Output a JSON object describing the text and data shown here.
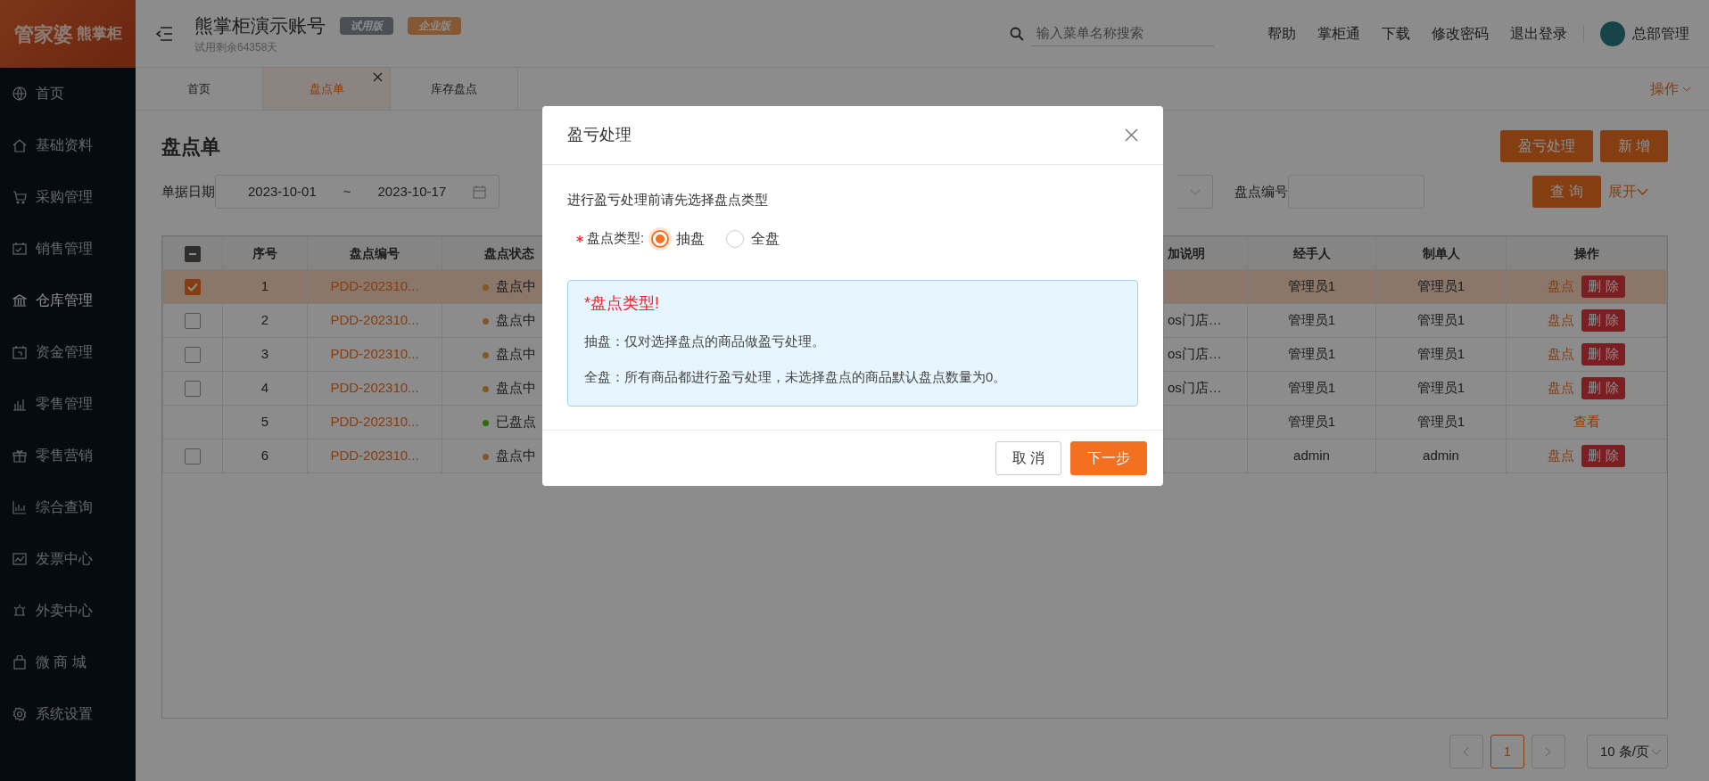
{
  "logo": {
    "brand": "管家婆",
    "product": "熊掌柜"
  },
  "sidebar": {
    "items": [
      {
        "label": "首页",
        "selected": false
      },
      {
        "label": "基础资料",
        "selected": false
      },
      {
        "label": "采购管理",
        "selected": false
      },
      {
        "label": "销售管理",
        "selected": false
      },
      {
        "label": "仓库管理",
        "selected": true
      },
      {
        "label": "资金管理",
        "selected": false
      },
      {
        "label": "零售管理",
        "selected": false
      },
      {
        "label": "零售营销",
        "selected": false
      },
      {
        "label": "综合查询",
        "selected": false
      },
      {
        "label": "发票中心",
        "selected": false
      },
      {
        "label": "外卖中心",
        "selected": false
      },
      {
        "label": "微 商 城",
        "selected": false
      },
      {
        "label": "系统设置",
        "selected": false
      }
    ]
  },
  "header": {
    "title": "熊掌柜演示账号",
    "badges": [
      {
        "label": "试用版",
        "kind": "trial"
      },
      {
        "label": "企业版",
        "kind": "enterprise"
      }
    ],
    "subtitle": "试用剩余64358天",
    "search": {
      "placeholder": "输入菜单名称搜索"
    },
    "links": [
      "帮助",
      "掌柜通",
      "下载",
      "修改密码",
      "退出登录"
    ],
    "user": "总部管理"
  },
  "tabs": [
    {
      "label": "首页",
      "selected": false,
      "closable": false
    },
    {
      "label": "盘点单",
      "selected": true,
      "closable": true
    },
    {
      "label": "库存盘点",
      "selected": false,
      "closable": false
    }
  ],
  "tabs_menu": "操作",
  "page": {
    "title": "盘点单",
    "buttons": [
      "盈亏处理",
      "新 增"
    ]
  },
  "filters": {
    "date_label": "单据日期",
    "date_from": "2023-10-01",
    "date_sep": "~",
    "date_to": "2023-10-17",
    "code_label": "盘点编号",
    "query": "查 询",
    "expand": "展开"
  },
  "table": {
    "header_indeterminate": true,
    "columns": [
      "序号",
      "盘点编号",
      "盘点状态",
      "加说明",
      "经手人",
      "制单人",
      "操作"
    ],
    "rows": [
      {
        "no": "1",
        "code": "PDD-202310...",
        "status": "盘点中",
        "color": "#7f5921",
        "note": "",
        "handler": "管理员1",
        "creator": "管理员1",
        "checked": true,
        "selected": true,
        "actions": [
          {
            "label": "盘点",
            "kind": "link"
          },
          {
            "label": "删 除",
            "kind": "danger"
          }
        ]
      },
      {
        "no": "2",
        "code": "PDD-202310...",
        "status": "盘点中",
        "color": "#7f5921",
        "note": "os门店…",
        "handler": "管理员1",
        "creator": "管理员1",
        "checked": false,
        "selected": false,
        "actions": [
          {
            "label": "盘点",
            "kind": "link"
          },
          {
            "label": "删 除",
            "kind": "danger"
          }
        ]
      },
      {
        "no": "3",
        "code": "PDD-202310...",
        "status": "盘点中",
        "color": "#7f5921",
        "note": "os门店…",
        "handler": "管理员1",
        "creator": "管理员1",
        "checked": false,
        "selected": false,
        "actions": [
          {
            "label": "盘点",
            "kind": "link"
          },
          {
            "label": "删 除",
            "kind": "danger"
          }
        ]
      },
      {
        "no": "4",
        "code": "PDD-202310...",
        "status": "盘点中",
        "color": "#7f5921",
        "note": "os门店…",
        "handler": "管理员1",
        "creator": "管理员1",
        "checked": false,
        "selected": false,
        "actions": [
          {
            "label": "盘点",
            "kind": "link"
          },
          {
            "label": "删 除",
            "kind": "danger"
          }
        ]
      },
      {
        "no": "5",
        "code": "PDD-202310...",
        "status": "已盘点",
        "color": "#2d6c0e",
        "note": "",
        "handler": "管理员1",
        "creator": "管理员1",
        "selected": false,
        "actions": [
          {
            "label": "查看",
            "kind": "link"
          }
        ]
      },
      {
        "no": "6",
        "code": "PDD-202310...",
        "status": "盘点中",
        "color": "#7f5921",
        "note": "",
        "handler": "admin",
        "creator": "admin",
        "checked": false,
        "selected": false,
        "actions": [
          {
            "label": "盘点",
            "kind": "link"
          },
          {
            "label": "删 除",
            "kind": "danger"
          }
        ]
      }
    ]
  },
  "pagination": {
    "pages": [
      {
        "label": "1",
        "selected": true
      }
    ],
    "page_size": "10 条/页"
  },
  "modal": {
    "title": "盈亏处理",
    "prompt": "进行盈亏处理前请先选择盘点类型",
    "field_label": "盘点类型:",
    "required": true,
    "options": [
      {
        "label": "抽盘",
        "selected": true
      },
      {
        "label": "全盘",
        "selected": false
      }
    ],
    "notice": {
      "title": "*盘点类型!",
      "lines": [
        "抽盘：仅对选择盘点的商品做盈亏处理。",
        "全盘：所有商品都进行盈亏处理，未选择盘点的商品默认盘点数量为0。"
      ]
    },
    "buttons": [
      {
        "label": "取 消",
        "kind": "default"
      },
      {
        "label": "下一步",
        "kind": "primary"
      }
    ]
  }
}
